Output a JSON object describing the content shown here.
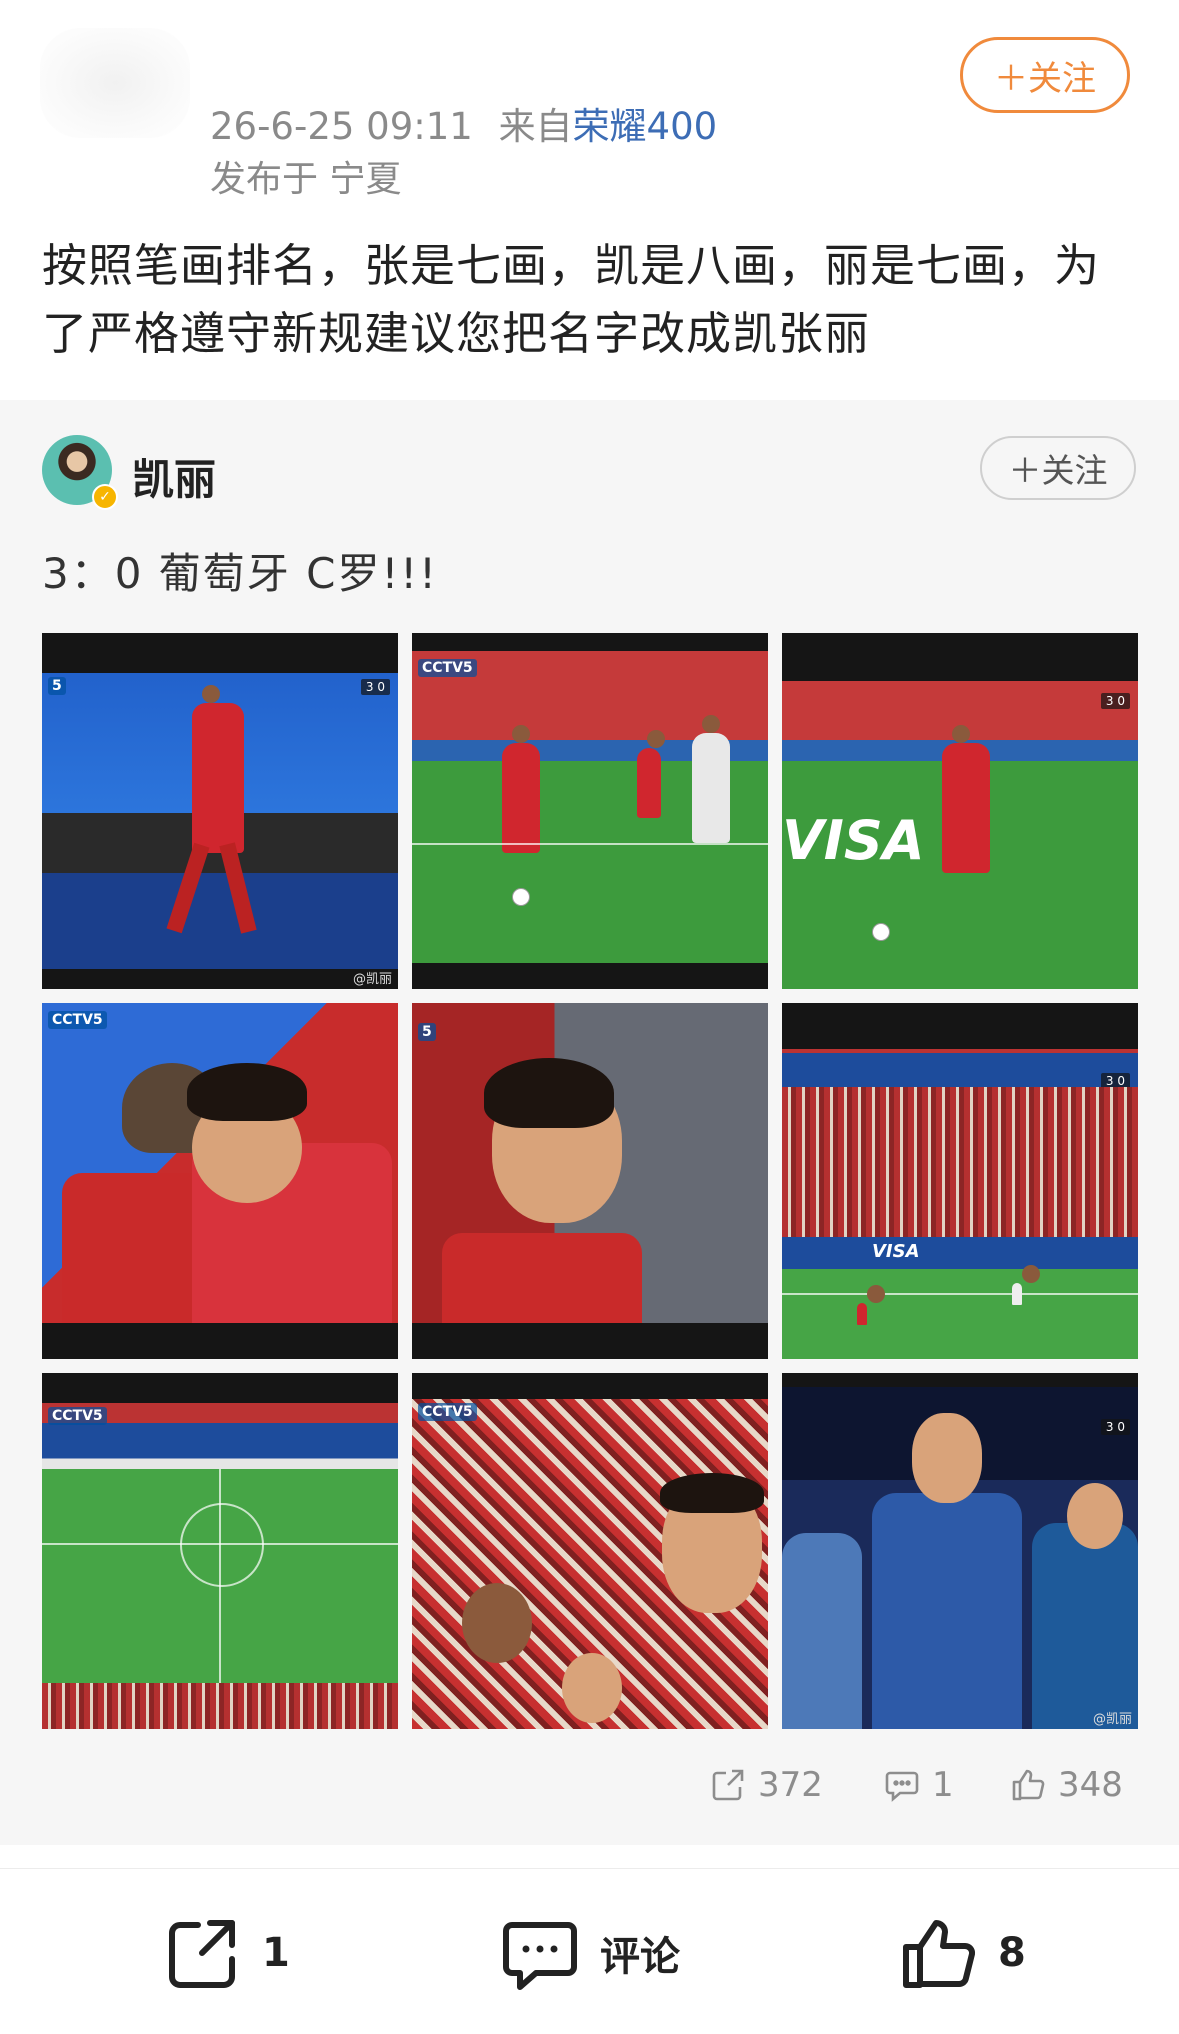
{
  "post": {
    "meta_time": "26-6-25 09:11",
    "meta_from": "来自",
    "meta_device": "荣耀400",
    "location": "发布于 宁夏",
    "follow_label": "＋关注",
    "text": "按照笔画排名，张是七画，凯是八画，丽是七画，为了严格遵守新规建议您把名字改成凯张丽"
  },
  "repost": {
    "author_name": "凯丽",
    "follow_label": "＋关注",
    "text": "3：0  葡萄牙  C罗!!!",
    "images": [
      {
        "watermark": "@凯丽",
        "logo": "5",
        "score": "3 0"
      },
      {
        "watermark": "",
        "logo": "CCTV5",
        "score": ""
      },
      {
        "watermark": "",
        "logo": "",
        "score": "3 0"
      },
      {
        "watermark": "",
        "logo": "CCTV5",
        "score": ""
      },
      {
        "watermark": "",
        "logo": "5",
        "score": ""
      },
      {
        "watermark": "",
        "logo": "",
        "score": "3 0"
      },
      {
        "watermark": "",
        "logo": "CCTV5",
        "score": ""
      },
      {
        "watermark": "",
        "logo": "CCTV5",
        "score": ""
      },
      {
        "watermark": "@凯丽",
        "logo": "",
        "score": "3 0"
      }
    ],
    "stats": {
      "reposts": "372",
      "comments": "1",
      "likes": "348"
    }
  },
  "action_bar": {
    "repost_count": "1",
    "comment_label": "评论",
    "like_count": "8"
  },
  "colors": {
    "accent_orange": "#f08a3c",
    "device_blue": "#3d6db5",
    "meta_gray": "#8a8a8a"
  }
}
